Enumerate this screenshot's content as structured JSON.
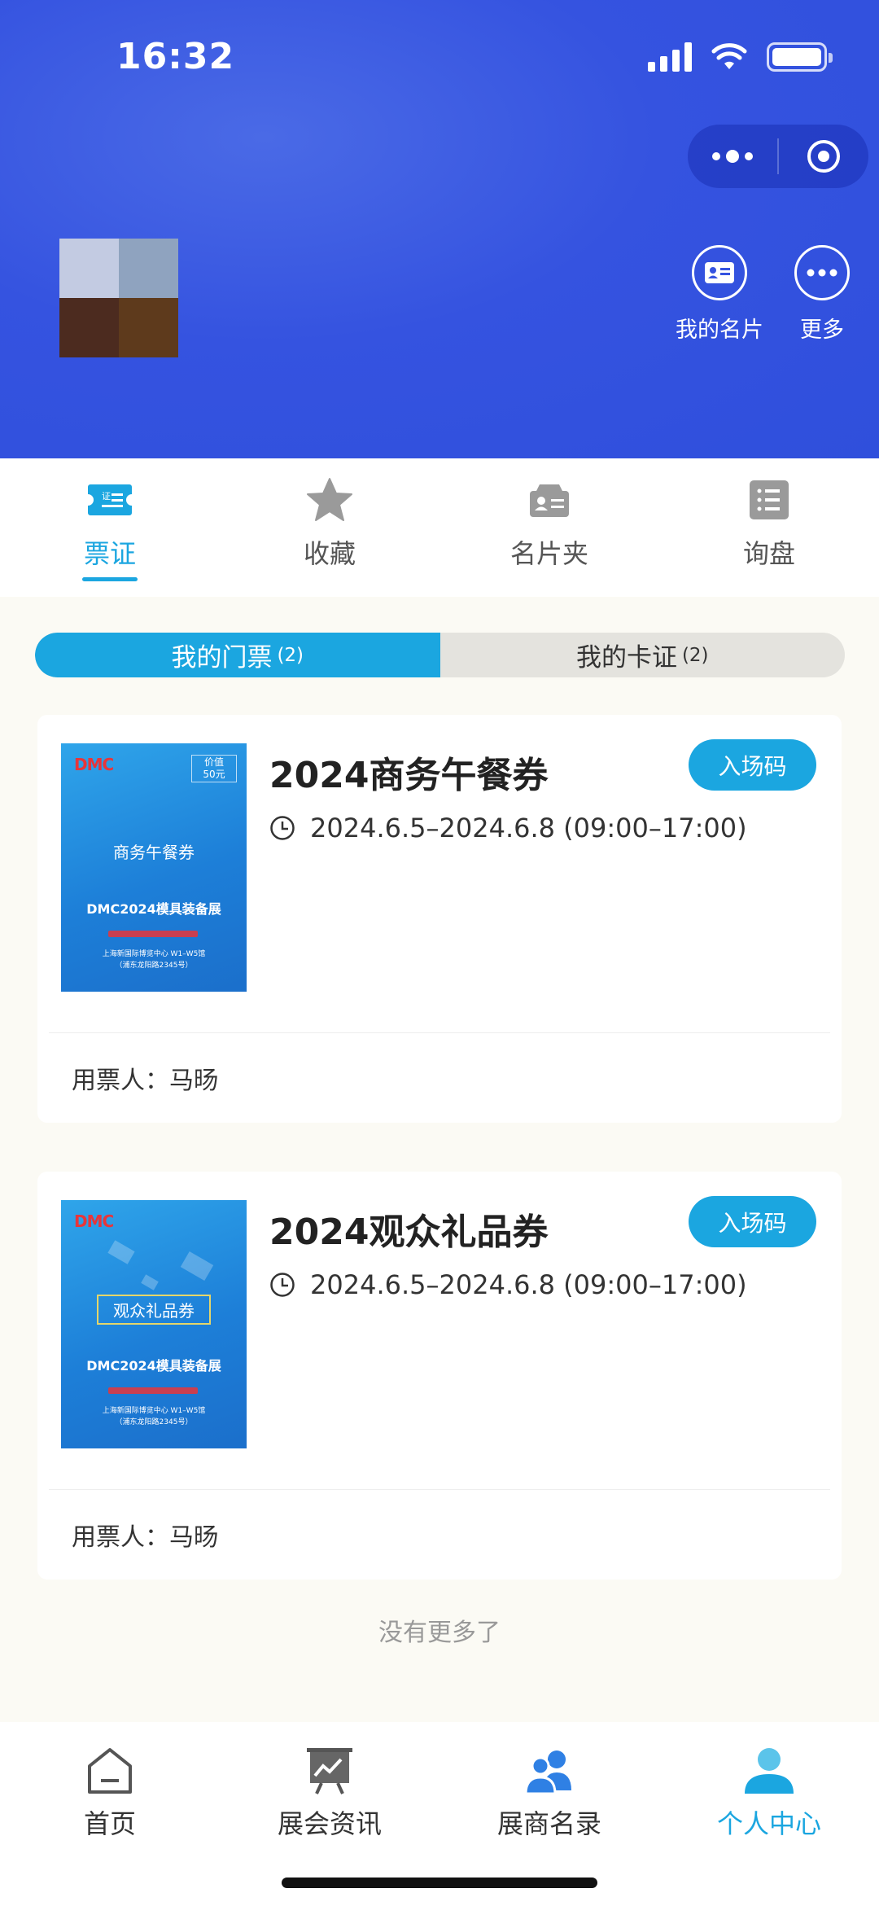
{
  "status_bar": {
    "time": "16:32"
  },
  "header": {
    "actions": [
      {
        "label": "我的名片",
        "icon": "business-card-icon"
      },
      {
        "label": "更多",
        "icon": "more-dots-icon"
      }
    ]
  },
  "tabs": [
    {
      "label": "票证",
      "icon": "ticket-icon",
      "active": true
    },
    {
      "label": "收藏",
      "icon": "star-icon",
      "active": false
    },
    {
      "label": "名片夹",
      "icon": "card-holder-icon",
      "active": false
    },
    {
      "label": "询盘",
      "icon": "inquiry-list-icon",
      "active": false
    }
  ],
  "segment": {
    "tickets_label": "我的门票",
    "tickets_count": "(2)",
    "cards_label": "我的卡证",
    "cards_count": "(2)"
  },
  "tickets": [
    {
      "title": "2024商务午餐券",
      "time": "2024.6.5–2024.6.8 (09:00–17:00)",
      "enter_label": "入场码",
      "holder": "用票人：马旸",
      "poster": {
        "logo": "DMC",
        "price": "价值\n50元",
        "name": "商务午餐券",
        "expo": "DMC2024模具装备展",
        "venue": "上海新国际博览中心 W1–W5馆\n（浦东龙阳路2345号）"
      }
    },
    {
      "title": "2024观众礼品券",
      "time": "2024.6.5–2024.6.8 (09:00–17:00)",
      "enter_label": "入场码",
      "holder": "用票人：马旸",
      "poster": {
        "logo": "DMC",
        "name": "观众礼品券",
        "expo": "DMC2024模具装备展",
        "venue": "上海新国际博览中心 W1–W5馆\n（浦东龙阳路2345号）"
      }
    }
  ],
  "no_more": "没有更多了",
  "bottom_nav": [
    {
      "label": "首页",
      "icon": "home-icon",
      "active": false
    },
    {
      "label": "展会资讯",
      "icon": "presentation-chart-icon",
      "active": false
    },
    {
      "label": "展商名录",
      "icon": "exhibitors-group-icon",
      "active": false
    },
    {
      "label": "个人中心",
      "icon": "user-icon",
      "active": true
    }
  ],
  "colors": {
    "header_blue": "#3553e0",
    "accent": "#1ba6e0"
  }
}
